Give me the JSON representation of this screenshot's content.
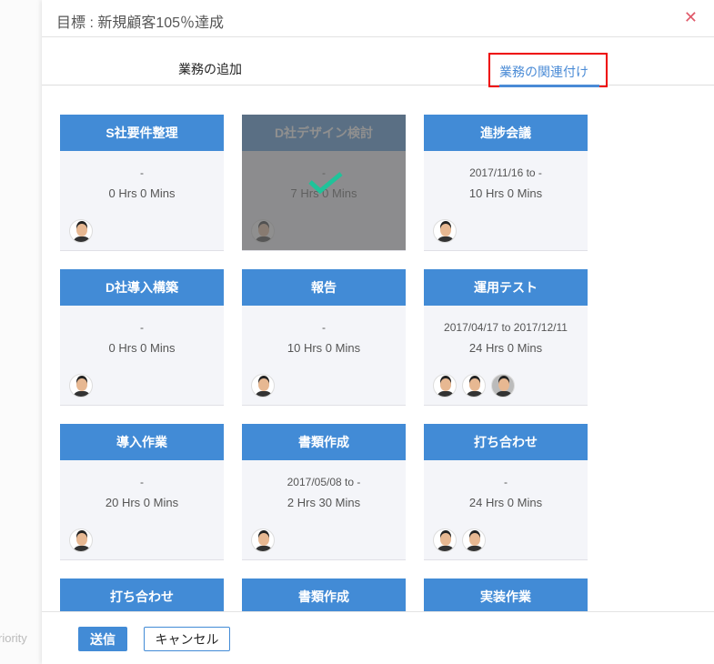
{
  "background": {
    "partial_text": "riority"
  },
  "modal": {
    "title": "目標 : 新規顧客105％達成",
    "close": "✕"
  },
  "tabs": [
    {
      "label": "業務の追加"
    },
    {
      "label": "業務の関連付け",
      "active": true
    }
  ],
  "cards": [
    {
      "title": "S社要件整理",
      "dates": "-",
      "hours": "0 Hrs 0 Mins",
      "avatars": 1
    },
    {
      "title": "D社デザイン検討",
      "dates": "-",
      "hours": "7 Hrs 0 Mins",
      "avatars": 1,
      "selected": true
    },
    {
      "title": "進捗会議",
      "dates": "2017/11/16 to -",
      "hours": "10 Hrs 0 Mins",
      "avatars": 1
    },
    {
      "title": "D社導入構築",
      "dates": "-",
      "hours": "0 Hrs 0 Mins",
      "avatars": 1
    },
    {
      "title": "報告",
      "dates": "-",
      "hours": "10 Hrs 0 Mins",
      "avatars": 1
    },
    {
      "title": "運用テスト",
      "dates": "2017/04/17 to 2017/12/11",
      "hours": "24 Hrs 0 Mins",
      "avatars": 3
    },
    {
      "title": "導入作業",
      "dates": "-",
      "hours": "20 Hrs 0 Mins",
      "avatars": 1
    },
    {
      "title": "書類作成",
      "dates": "2017/05/08 to -",
      "hours": "2 Hrs 30 Mins",
      "avatars": 1
    },
    {
      "title": "打ち合わせ",
      "dates": "-",
      "hours": "24 Hrs 0 Mins",
      "avatars": 2
    },
    {
      "title": "打ち合わせ"
    },
    {
      "title": "書類作成"
    },
    {
      "title": "実装作業"
    }
  ],
  "footer": {
    "submit": "送信",
    "cancel": "キャンセル"
  },
  "colors": {
    "accent": "#428bd6",
    "close": "#e05a6a",
    "check": "#1fc39a"
  }
}
